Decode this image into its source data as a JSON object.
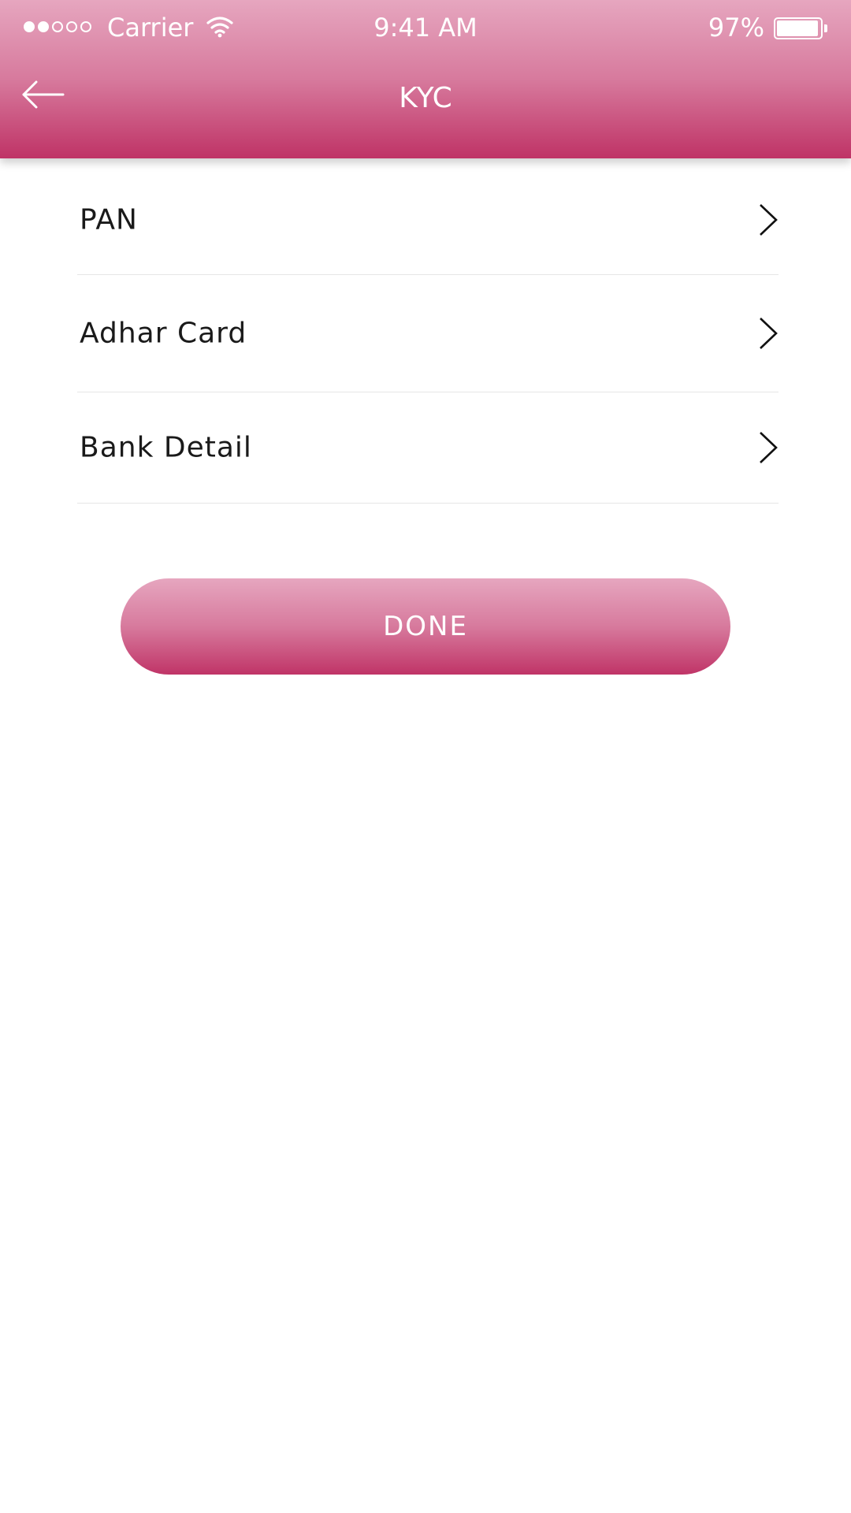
{
  "status_bar": {
    "carrier": "Carrier",
    "time": "9:41 AM",
    "battery_percent": "97%",
    "signal_bars_filled": 2,
    "signal_bars_total": 5,
    "battery_level": 0.97
  },
  "header": {
    "title": "KYC",
    "back_icon": "arrow-left-icon"
  },
  "kyc_items": [
    {
      "label": "PAN",
      "icon": "chevron-right-icon"
    },
    {
      "label": "Adhar Card",
      "icon": "chevron-right-icon"
    },
    {
      "label": "Bank Detail",
      "icon": "chevron-right-icon"
    }
  ],
  "actions": {
    "done_label": "DONE"
  },
  "colors": {
    "accent_light": "#e6a6bf",
    "accent_dark": "#bf3366",
    "divider": "#e6e6e6",
    "text": "#1a1a1a"
  }
}
